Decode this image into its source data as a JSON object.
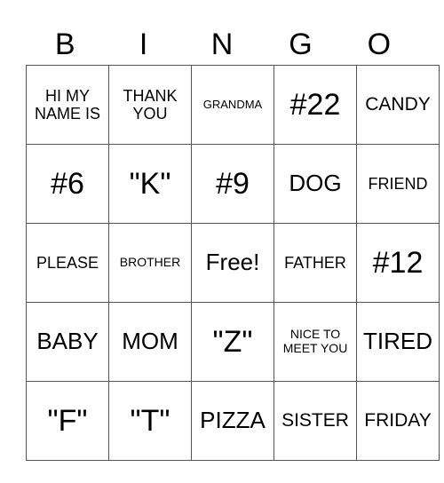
{
  "header": [
    "B",
    "I",
    "N",
    "G",
    "O"
  ],
  "rows": [
    [
      {
        "text": "HI MY NAME IS",
        "size": "s-sm"
      },
      {
        "text": "THANK YOU",
        "size": "s-sm"
      },
      {
        "text": "GRANDMA",
        "size": "s-tiny"
      },
      {
        "text": "#22",
        "size": "s-xl"
      },
      {
        "text": "CANDY",
        "size": "s-md"
      }
    ],
    [
      {
        "text": "#6",
        "size": "s-xl"
      },
      {
        "text": "\"K\"",
        "size": "s-xl"
      },
      {
        "text": "#9",
        "size": "s-xl"
      },
      {
        "text": "DOG",
        "size": "s-lg"
      },
      {
        "text": "FRIEND",
        "size": "s-sm"
      }
    ],
    [
      {
        "text": "PLEASE",
        "size": "s-sm"
      },
      {
        "text": "BROTHER",
        "size": "s-xxs"
      },
      {
        "text": "Free!",
        "size": "s-lg"
      },
      {
        "text": "FATHER",
        "size": "s-sm"
      },
      {
        "text": "#12",
        "size": "s-xl"
      }
    ],
    [
      {
        "text": "BABY",
        "size": "s-lg"
      },
      {
        "text": "MOM",
        "size": "s-lg"
      },
      {
        "text": "\"Z\"",
        "size": "s-xl"
      },
      {
        "text": "NICE TO MEET YOU",
        "size": "s-xxs"
      },
      {
        "text": "TIRED",
        "size": "s-lg"
      }
    ],
    [
      {
        "text": "\"F\"",
        "size": "s-xl"
      },
      {
        "text": "\"T\"",
        "size": "s-xl"
      },
      {
        "text": "PIZZA",
        "size": "s-lg"
      },
      {
        "text": "SISTER",
        "size": "s-md"
      },
      {
        "text": "FRIDAY",
        "size": "s-md"
      }
    ]
  ]
}
